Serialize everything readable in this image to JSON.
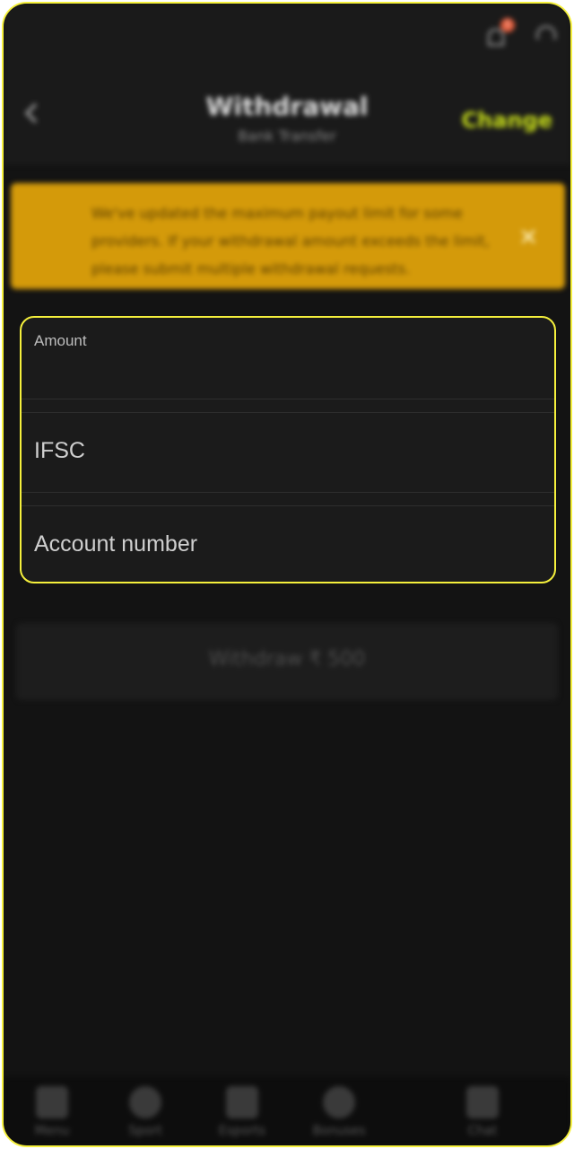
{
  "header": {
    "title": "Withdrawal",
    "subtitle": "Bank Transfer",
    "change_label": "Change",
    "notification_count": "1"
  },
  "notice": {
    "text": "We've updated the maximum payout limit for some providers. If your withdrawal amount exceeds the limit, please submit multiple withdrawal requests.",
    "close_symbol": "✕"
  },
  "form": {
    "amount_label": "Amount",
    "amount_value": "",
    "ifsc_label": "IFSC",
    "account_label": "Account number"
  },
  "withdraw_button": {
    "label": "Withdraw ₹ 500"
  },
  "bottom_nav": {
    "items": [
      {
        "label": "Menu",
        "icon": "menu-icon"
      },
      {
        "label": "Sport",
        "icon": "sport-icon"
      },
      {
        "label": "Esports",
        "icon": "gamepad-icon"
      },
      {
        "label": "Bonuses",
        "icon": "gift-icon"
      },
      {
        "label": "Chat",
        "icon": "chat-icon"
      }
    ]
  },
  "colors": {
    "accent": "#c9e01a",
    "notice_bg": "#d49a0a",
    "highlight": "#f5f03c",
    "background": "#131313"
  }
}
